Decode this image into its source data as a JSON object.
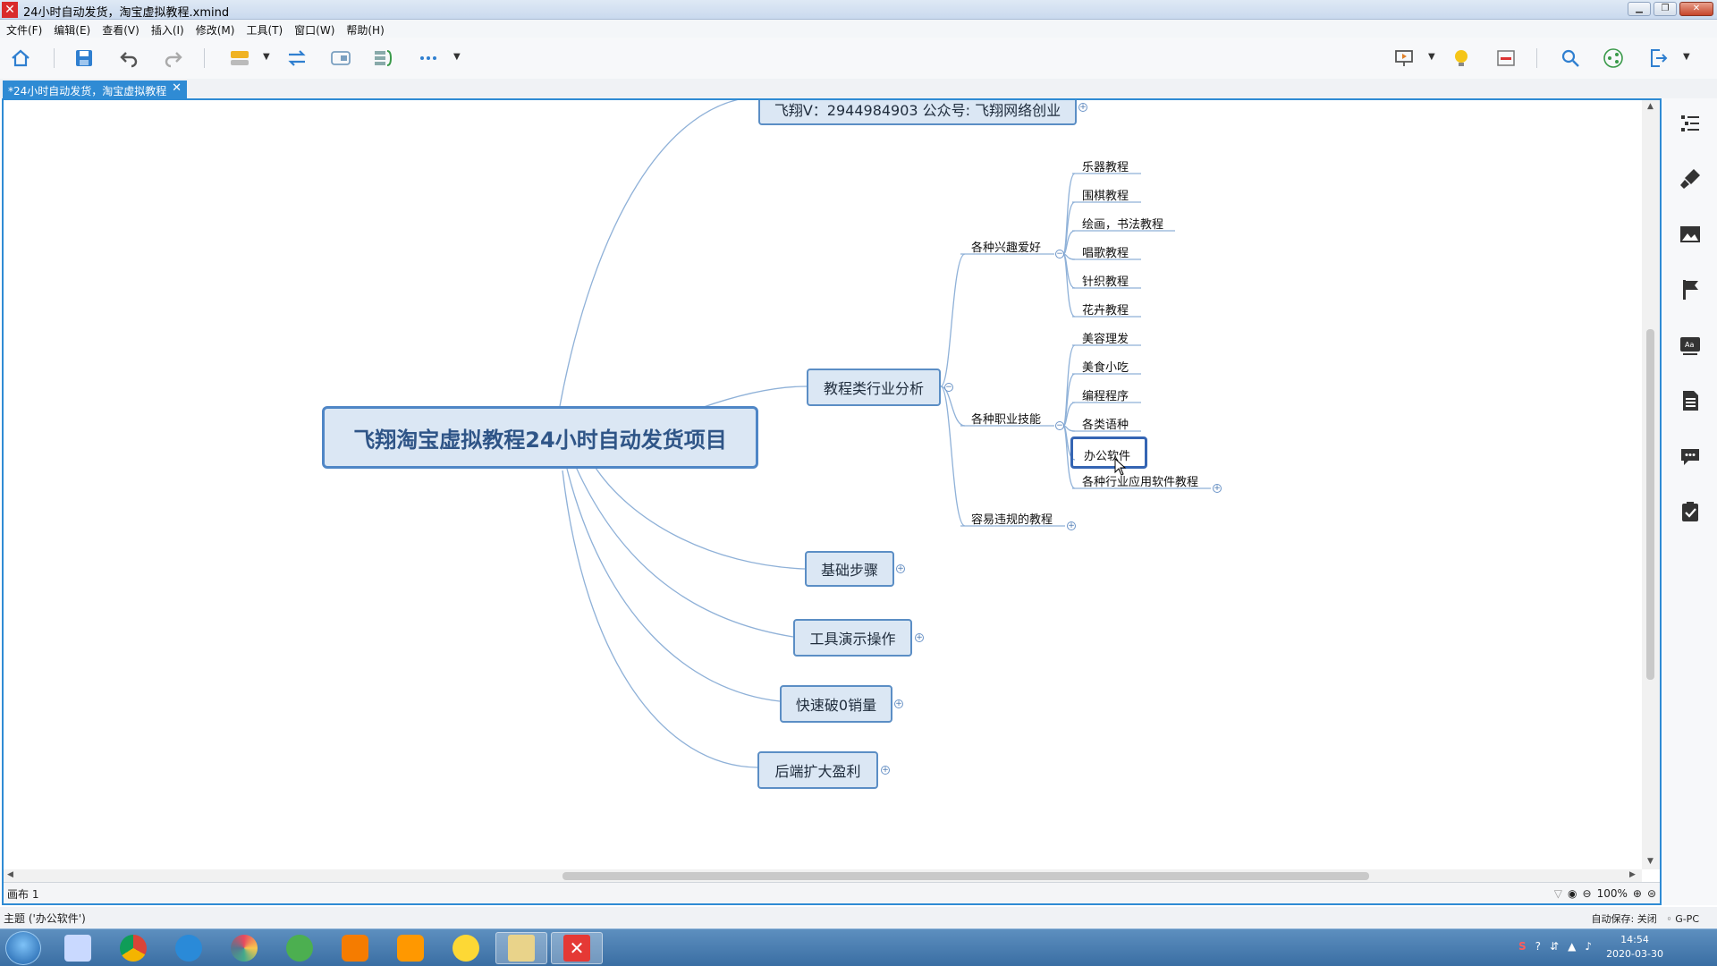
{
  "window": {
    "title": "24小时自动发货，淘宝虚拟教程.xmind"
  },
  "menu": [
    "文件(F)",
    "编辑(E)",
    "查看(V)",
    "插入(I)",
    "修改(M)",
    "工具(T)",
    "窗口(W)",
    "帮助(H)"
  ],
  "tab": {
    "label": "*24小时自动发货，淘宝虚拟教程",
    "close": "✕"
  },
  "mindmap": {
    "central": "飞翔淘宝虚拟教程24小时自动发货项目",
    "top_partial": "飞翔V：2944984903 公众号: 飞翔网络创业",
    "branches": {
      "analysis": "教程类行业分析",
      "basic": "基础步骤",
      "tools": "工具演示操作",
      "zero_sales": "快速破0销量",
      "profit": "后端扩大盈利"
    },
    "subs": {
      "hobby": "各种兴趣爱好",
      "skills": "各种职业技能",
      "violation": "容易违规的教程"
    },
    "hobby_leaves": [
      "乐器教程",
      "围棋教程",
      "绘画，书法教程",
      "唱歌教程",
      "针织教程",
      "花卉教程"
    ],
    "skill_leaves": [
      "美容理发",
      "美食小吃",
      "编程程序",
      "各类语种",
      "办公软件",
      "各种行业应用软件教程"
    ]
  },
  "sheet": {
    "tab": "画布 1",
    "zoom": "100%"
  },
  "status": {
    "left": "主题 ('办公软件')",
    "autosave": "自动保存: 关闭",
    "user": "G-PC"
  },
  "clock": {
    "time": "14:54",
    "date": "2020-03-30"
  }
}
